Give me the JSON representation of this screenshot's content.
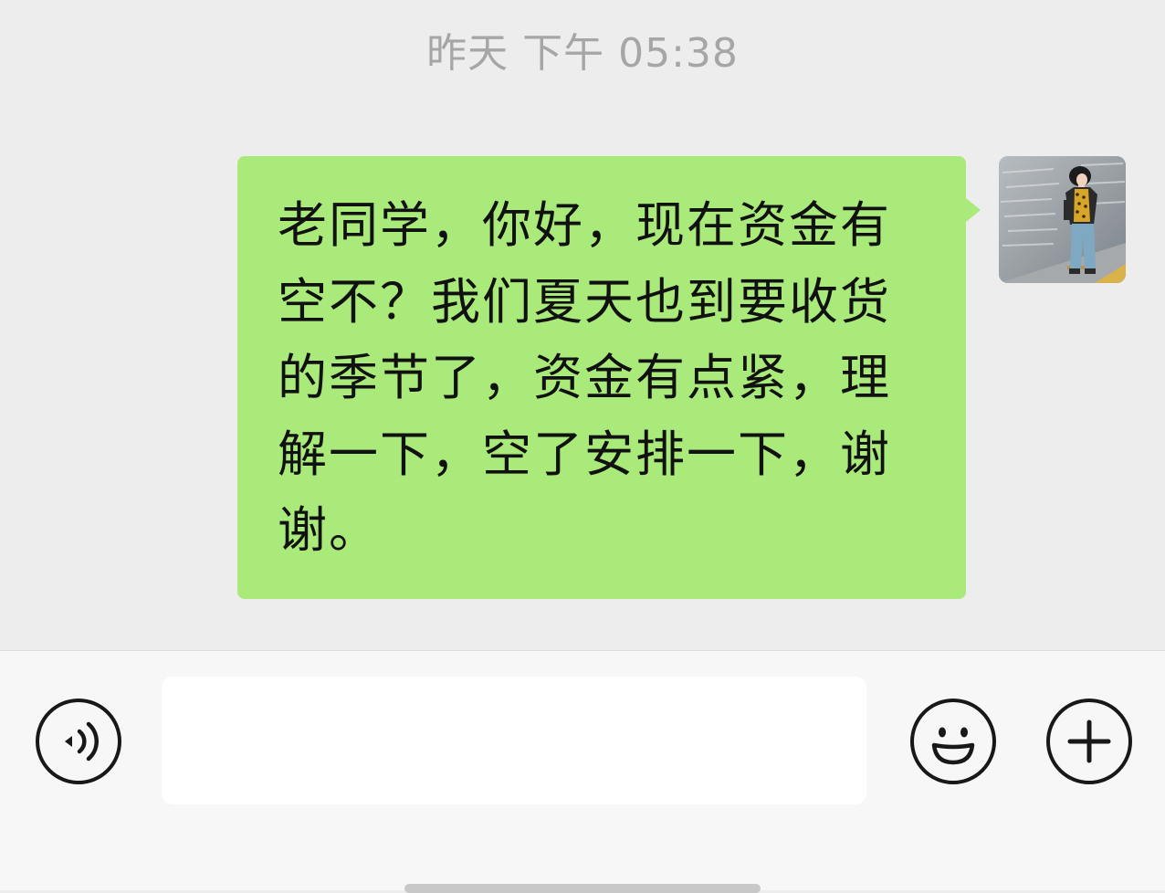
{
  "chat": {
    "timestamp": "昨天 下午 05:38",
    "messages": [
      {
        "sender": "self",
        "text": "老同学，你好，现在资金有空不？我们夏天也到要收货的季节了，资金有点紧，理解一下，空了安排一下，谢谢。"
      }
    ]
  },
  "input_bar": {
    "placeholder": "",
    "voice_icon": "voice-icon",
    "emoji_icon": "emoji-icon",
    "plus_icon": "plus-icon"
  },
  "colors": {
    "chat_background": "#ededed",
    "bubble_self": "#a9ea7a",
    "timestamp_text": "#a6a6a6",
    "input_bar_background": "#f7f7f7"
  }
}
